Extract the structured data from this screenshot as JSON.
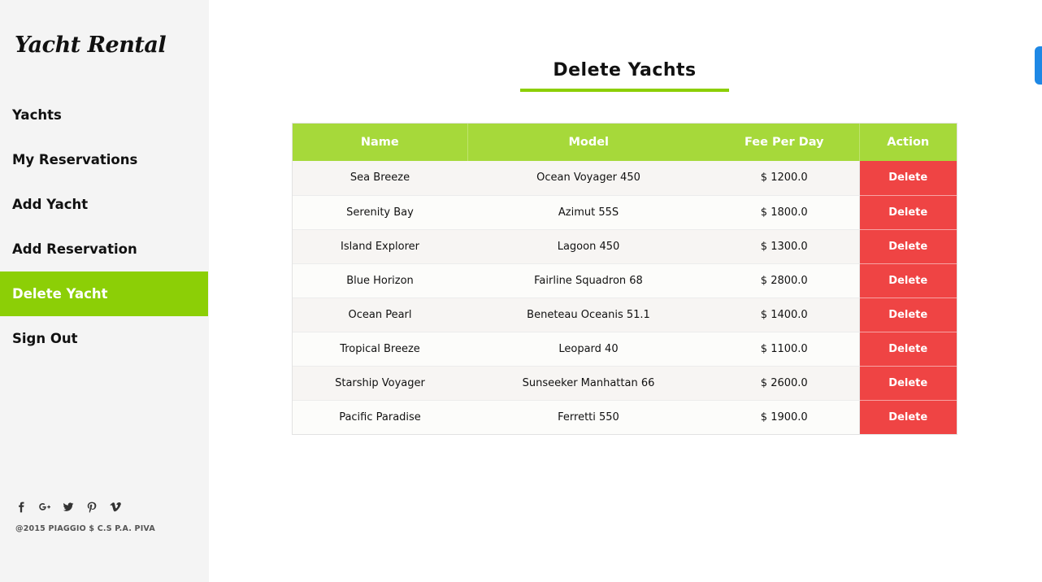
{
  "brand": {
    "logo_text": "Yacht Rental"
  },
  "sidebar": {
    "items": [
      {
        "label": "Yachts",
        "active": false
      },
      {
        "label": "My Reservations",
        "active": false
      },
      {
        "label": "Add Yacht",
        "active": false
      },
      {
        "label": "Add Reservation",
        "active": false
      },
      {
        "label": "Delete Yacht",
        "active": true
      },
      {
        "label": "Sign Out",
        "active": false
      }
    ],
    "social_icons": [
      "facebook-icon",
      "google-plus-icon",
      "twitter-icon",
      "pinterest-icon",
      "vimeo-icon"
    ],
    "copyright": "@2015 PIAGGIO $ C.S P.A. PIVA"
  },
  "main": {
    "title": "Delete Yachts",
    "table": {
      "headers": [
        "Name",
        "Model",
        "Fee Per Day",
        "Action"
      ],
      "rows": [
        {
          "name": "Sea Breeze",
          "model": "Ocean Voyager 450",
          "fee": "$ 1200.0",
          "action": "Delete"
        },
        {
          "name": "Serenity Bay",
          "model": "Azimut 55S",
          "fee": "$ 1800.0",
          "action": "Delete"
        },
        {
          "name": "Island Explorer",
          "model": "Lagoon 450",
          "fee": "$ 1300.0",
          "action": "Delete"
        },
        {
          "name": "Blue Horizon",
          "model": "Fairline Squadron 68",
          "fee": "$ 2800.0",
          "action": "Delete"
        },
        {
          "name": "Ocean Pearl",
          "model": "Beneteau Oceanis 51.1",
          "fee": "$ 1400.0",
          "action": "Delete"
        },
        {
          "name": "Tropical Breeze",
          "model": "Leopard 40",
          "fee": "$ 1100.0",
          "action": "Delete"
        },
        {
          "name": "Starship Voyager",
          "model": "Sunseeker Manhattan 66",
          "fee": "$ 2600.0",
          "action": "Delete"
        },
        {
          "name": "Pacific Paradise",
          "model": "Ferretti 550",
          "fee": "$ 1900.0",
          "action": "Delete"
        }
      ]
    }
  },
  "colors": {
    "accent_green": "#8ccf06",
    "header_green": "#a6d93a",
    "delete_red": "#ef4444",
    "sidebar_bg": "#f4f4f4"
  }
}
